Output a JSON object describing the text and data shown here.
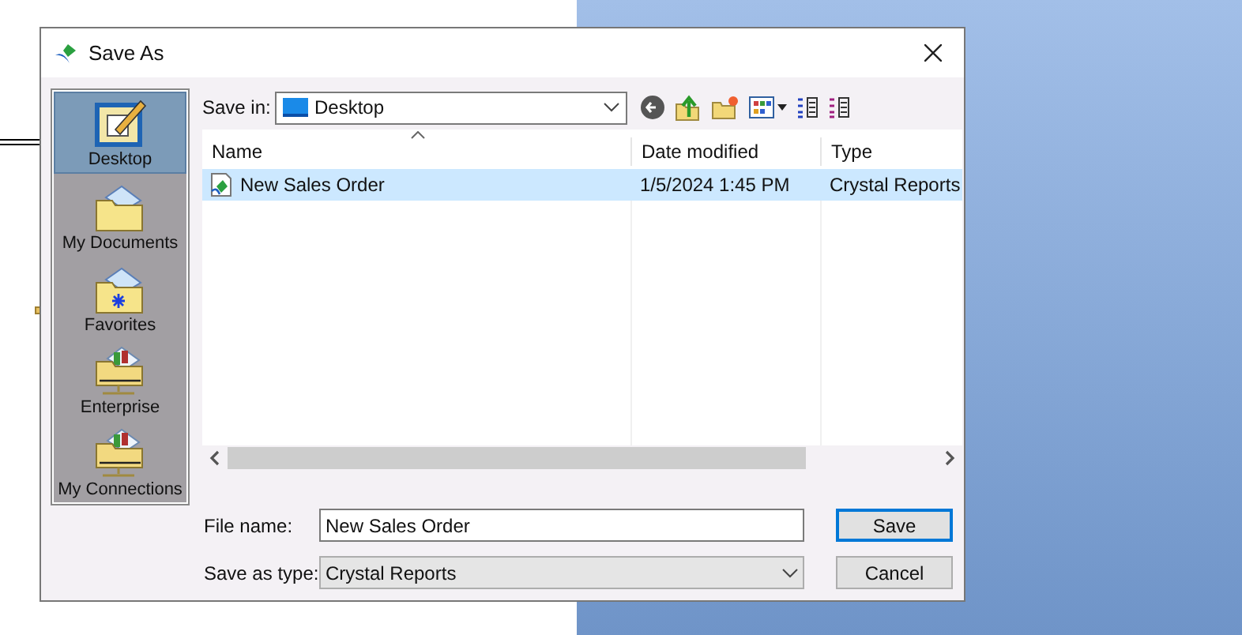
{
  "window": {
    "title": "Save As"
  },
  "places": [
    {
      "label": "Desktop",
      "kind": "desktop",
      "selected": true
    },
    {
      "label": "My Documents",
      "kind": "documents",
      "selected": false
    },
    {
      "label": "Favorites",
      "kind": "favorites",
      "selected": false
    },
    {
      "label": "Enterprise",
      "kind": "enterprise",
      "selected": false
    },
    {
      "label": "My Connections",
      "kind": "enterprise",
      "selected": false
    }
  ],
  "save_in": {
    "label": "Save in:",
    "value": "Desktop"
  },
  "table": {
    "columns": [
      "Name",
      "Date modified",
      "Type"
    ],
    "rows": [
      {
        "name": "New Sales Order",
        "date": "1/5/2024 1:45 PM",
        "type": "Crystal Reports",
        "selected": true
      }
    ]
  },
  "file_name": {
    "label": "File name:",
    "value": "New Sales Order"
  },
  "save_as_type": {
    "label": "Save as type:",
    "value": "Crystal Reports"
  },
  "buttons": [
    {
      "label": "Save",
      "kind": "default"
    },
    {
      "label": "Cancel",
      "kind": "normal"
    }
  ]
}
